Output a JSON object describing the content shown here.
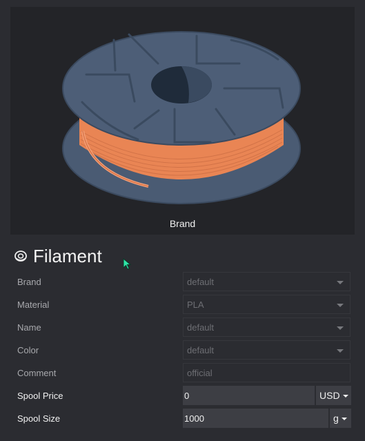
{
  "preview": {
    "caption": "Brand"
  },
  "section": {
    "title": "Filament",
    "icon": "filament-spool-icon"
  },
  "fields": {
    "brand": {
      "label": "Brand",
      "value": "default"
    },
    "material": {
      "label": "Material",
      "value": "PLA"
    },
    "name": {
      "label": "Name",
      "value": "default"
    },
    "color": {
      "label": "Color",
      "value": "default"
    },
    "comment": {
      "label": "Comment",
      "value": "official"
    },
    "spool_price": {
      "label": "Spool Price",
      "value": "0",
      "unit": "USD"
    },
    "spool_size": {
      "label": "Spool Size",
      "value": "1000",
      "unit": "g"
    }
  },
  "colors": {
    "background": "#2b2c31",
    "spool": "#4a5b73",
    "filament": "#f08a58",
    "input_active": "#3d3e44"
  }
}
